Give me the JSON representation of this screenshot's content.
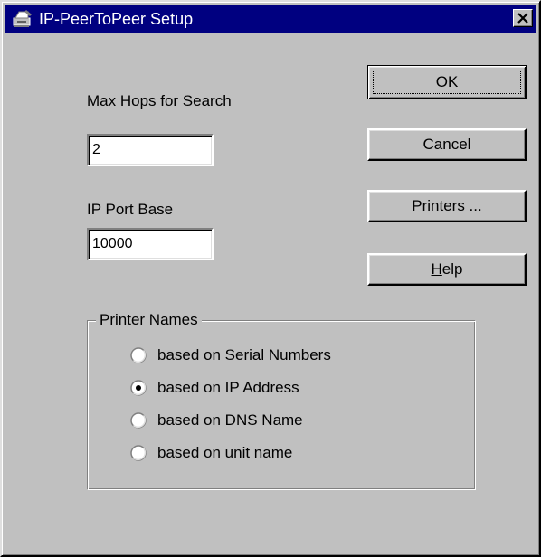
{
  "window": {
    "title": "IP-PeerToPeer Setup",
    "title_icon": "printer-icon",
    "close_icon": "close-icon"
  },
  "fields": {
    "max_hops_label": "Max Hops for Search",
    "max_hops_value": "2",
    "port_base_label": "IP Port Base",
    "port_base_value": "10000"
  },
  "buttons": {
    "ok": "OK",
    "cancel": "Cancel",
    "printers": "Printers ...",
    "help_accel": "H",
    "help_rest": "elp"
  },
  "printer_names": {
    "title": "Printer Names",
    "selected_index": 1,
    "options": [
      {
        "label": "based on Serial Numbers",
        "checked": false
      },
      {
        "label": "based on IP Address",
        "checked": true
      },
      {
        "label": "based on DNS Name",
        "checked": false
      },
      {
        "label": "based on unit name",
        "checked": false
      }
    ]
  },
  "colors": {
    "titlebar": "#000080",
    "face": "#c0c0c0"
  }
}
